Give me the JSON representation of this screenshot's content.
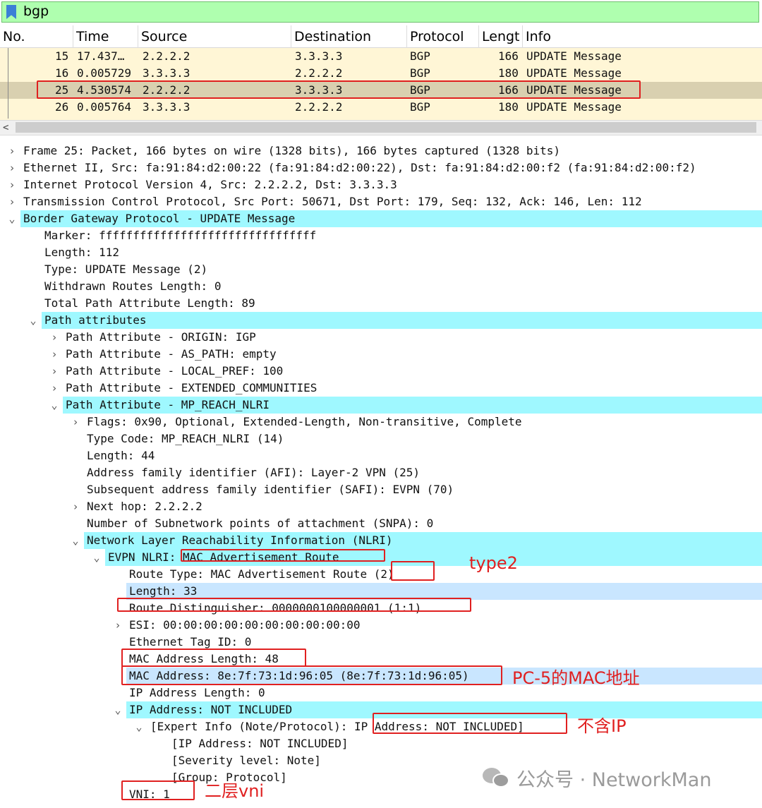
{
  "filter": {
    "value": "bgp"
  },
  "packet_list": {
    "columns": [
      "No.",
      "Time",
      "Source",
      "Destination",
      "Protocol",
      "Lengt",
      "Info"
    ],
    "rows": [
      {
        "no": "15",
        "time": "17.437…",
        "src": "2.2.2.2",
        "dst": "3.3.3.3",
        "proto": "BGP",
        "len": "166",
        "info": "UPDATE Message"
      },
      {
        "no": "16",
        "time": "0.005729",
        "src": "3.3.3.3",
        "dst": "2.2.2.2",
        "proto": "BGP",
        "len": "180",
        "info": "UPDATE Message"
      },
      {
        "no": "25",
        "time": "4.530574",
        "src": "2.2.2.2",
        "dst": "3.3.3.3",
        "proto": "BGP",
        "len": "166",
        "info": "UPDATE Message"
      },
      {
        "no": "26",
        "time": "0.005764",
        "src": "3.3.3.3",
        "dst": "2.2.2.2",
        "proto": "BGP",
        "len": "180",
        "info": "UPDATE Message"
      }
    ]
  },
  "details": [
    {
      "arrow": ">",
      "text": "Frame 25: Packet, 166 bytes on wire (1328 bits), 166 bytes captured (1328 bits)"
    },
    {
      "arrow": ">",
      "text": "Ethernet II, Src: fa:91:84:d2:00:22 (fa:91:84:d2:00:22), Dst: fa:91:84:d2:00:f2 (fa:91:84:d2:00:f2)"
    },
    {
      "arrow": ">",
      "text": "Internet Protocol Version 4, Src: 2.2.2.2, Dst: 3.3.3.3"
    },
    {
      "arrow": ">",
      "text": "Transmission Control Protocol, Src Port: 50671, Dst Port: 179, Seq: 132, Ack: 146, Len: 112"
    },
    {
      "arrow": "v",
      "text": "Border Gateway Protocol - UPDATE Message"
    },
    {
      "arrow": "",
      "text": "Marker: ffffffffffffffffffffffffffffffff"
    },
    {
      "arrow": "",
      "text": "Length: 112"
    },
    {
      "arrow": "",
      "text": "Type: UPDATE Message (2)"
    },
    {
      "arrow": "",
      "text": "Withdrawn Routes Length: 0"
    },
    {
      "arrow": "",
      "text": "Total Path Attribute Length: 89"
    },
    {
      "arrow": "v",
      "text": "Path attributes"
    },
    {
      "arrow": ">",
      "text": "Path Attribute - ORIGIN: IGP"
    },
    {
      "arrow": ">",
      "text": "Path Attribute - AS_PATH: empty"
    },
    {
      "arrow": ">",
      "text": "Path Attribute - LOCAL_PREF: 100"
    },
    {
      "arrow": ">",
      "text": "Path Attribute - EXTENDED_COMMUNITIES"
    },
    {
      "arrow": "v",
      "text": "Path Attribute - MP_REACH_NLRI"
    },
    {
      "arrow": ">",
      "text": "Flags: 0x90, Optional, Extended-Length, Non-transitive, Complete"
    },
    {
      "arrow": "",
      "text": "Type Code: MP_REACH_NLRI (14)"
    },
    {
      "arrow": "",
      "text": "Length: 44"
    },
    {
      "arrow": "",
      "text": "Address family identifier (AFI): Layer-2 VPN (25)"
    },
    {
      "arrow": "",
      "text": "Subsequent address family identifier (SAFI): EVPN (70)"
    },
    {
      "arrow": ">",
      "text": "Next hop: 2.2.2.2"
    },
    {
      "arrow": "",
      "text": "Number of Subnetwork points of attachment (SNPA): 0"
    },
    {
      "arrow": "v",
      "text": "Network Layer Reachability Information (NLRI)"
    },
    {
      "arrow": "v",
      "text": "EVPN NLRI: MAC Advertisement Route"
    },
    {
      "arrow": "",
      "text": "Route Type: MAC Advertisement Route (2)"
    },
    {
      "arrow": "",
      "text": "Length: 33"
    },
    {
      "arrow": "",
      "text": "Route Distinguisher: 0000000100000001 (1:1)"
    },
    {
      "arrow": ">",
      "text": "ESI: 00:00:00:00:00:00:00:00:00:00"
    },
    {
      "arrow": "",
      "text": "Ethernet Tag ID: 0"
    },
    {
      "arrow": "",
      "text": "MAC Address Length: 48"
    },
    {
      "arrow": "",
      "text": "MAC Address: 8e:7f:73:1d:96:05 (8e:7f:73:1d:96:05)"
    },
    {
      "arrow": "",
      "text": "IP Address Length: 0"
    },
    {
      "arrow": "v",
      "text": "IP Address: NOT INCLUDED"
    },
    {
      "arrow": "v",
      "text": "[Expert Info (Note/Protocol): IP Address: NOT INCLUDED]"
    },
    {
      "arrow": "",
      "text": "[IP Address: NOT INCLUDED]"
    },
    {
      "arrow": "",
      "text": "[Severity level: Note]"
    },
    {
      "arrow": "",
      "text": "[Group: Protocol]"
    },
    {
      "arrow": "",
      "text": "VNI: 1"
    }
  ],
  "annotations": {
    "type2": "type2",
    "mac": "PC-5的MAC地址",
    "no_ip": "不含IP",
    "l2vni": "二层vni"
  },
  "watermark": {
    "text": "公众号 · NetworkMan"
  },
  "colors": {
    "filter_bg": "#afffaf",
    "row_bg": "#fff6d6",
    "highlight": "#9ff8ff",
    "annotation": "#e02020"
  }
}
